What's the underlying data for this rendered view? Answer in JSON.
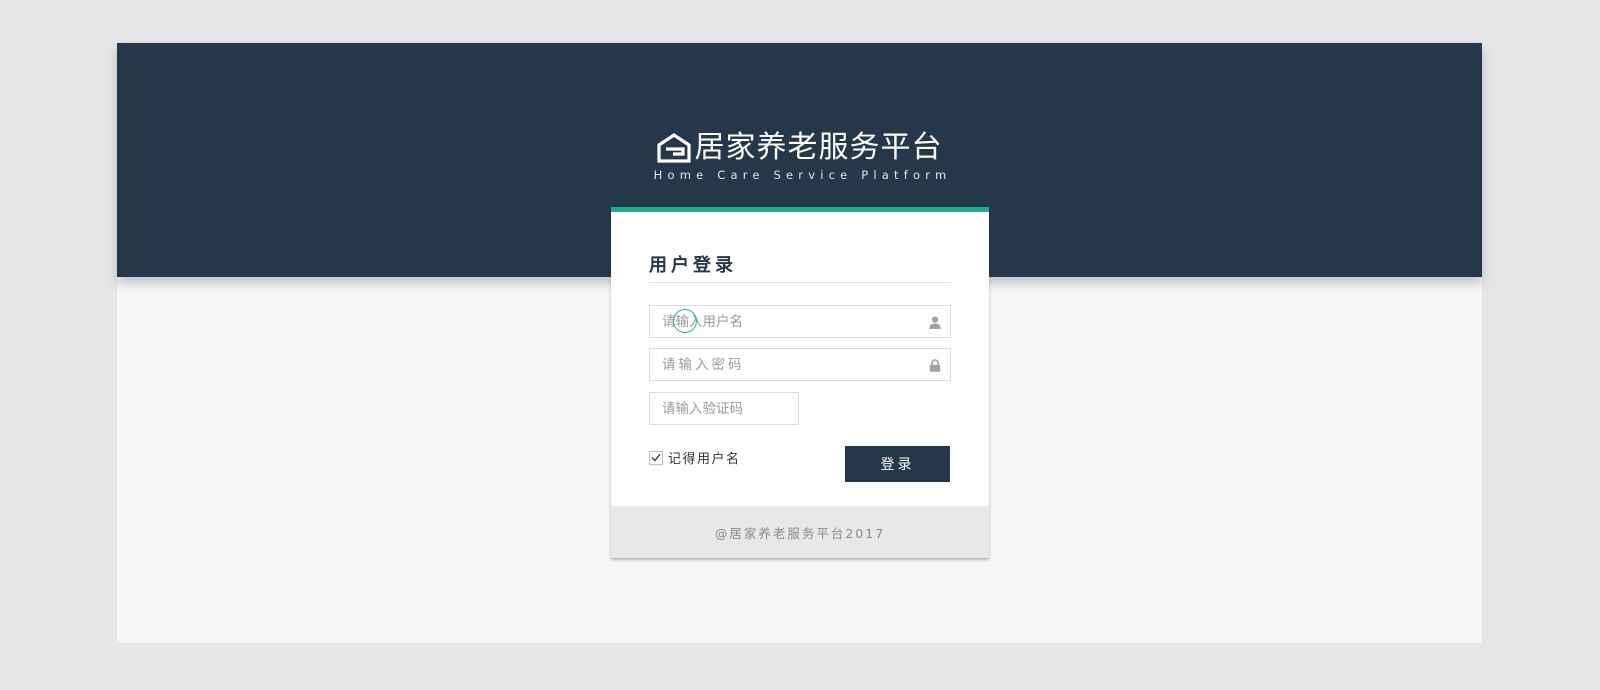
{
  "brand": {
    "logo_icon": "house-g-logo-icon",
    "name": "居家养老服务平台",
    "subtitle": "Home Care Service Platform"
  },
  "login": {
    "title": "用户登录",
    "username_placeholder": "请输入用户名",
    "username_icon": "user-icon",
    "password_placeholder": "请输入密码",
    "password_icon": "lock-icon",
    "captcha_placeholder": "请输入验证码",
    "remember_checked": true,
    "remember_label": "记得用户名",
    "submit_label": "登录",
    "footer": "@居家养老服务平台2017"
  },
  "colors": {
    "banner": "#25384a",
    "accent": "#14b38e",
    "button": "#25384a",
    "background": "#f5f5f5"
  }
}
